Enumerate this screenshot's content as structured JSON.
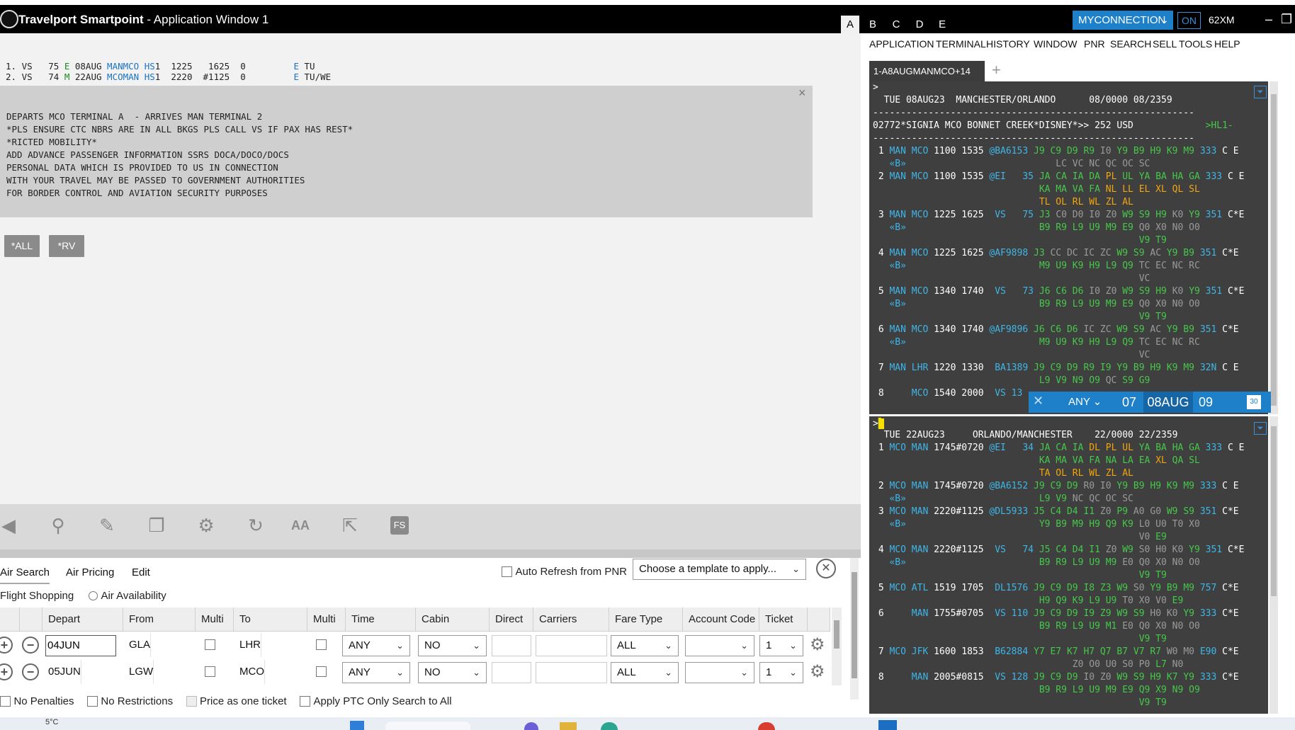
{
  "window": {
    "app_name": "Travelport Smartpoint",
    "title_suffix": " - Application Window 1",
    "tabs": [
      "A",
      "B",
      "C",
      "D",
      "E"
    ],
    "connection": "MYCONNECTION",
    "on_label": "ON",
    "station": "62XM"
  },
  "segments": {
    "line1": {
      "num": "1. VS",
      "flight": "75",
      "cls": "E",
      "date": "08AUG",
      "city": "MANMCO",
      "status": "HS",
      "rest": "1  1225   1625  0         ",
      "e": "E",
      "days": "TU"
    },
    "line2": {
      "num": "2. VS",
      "flight": "74",
      "cls": "M",
      "date": "22AUG",
      "city": "MCOMAN",
      "status": "HS",
      "rest": "1  2220  #1125  0         ",
      "e": "E",
      "days": "TU/WE"
    }
  },
  "info": {
    "lines": [
      "DEPARTS MCO TERMINAL A  - ARRIVES MAN TERMINAL 2",
      "*PLS ENSURE CTC NBRS ARE IN ALL BKGS PLS CALL VS IF PAX HAS REST*",
      "*RICTED MOBILITY*",
      "ADD ADVANCE PASSENGER INFORMATION SSRS DOCA/DOCO/DOCS",
      "PERSONAL DATA WHICH IS PROVIDED TO US IN CONNECTION",
      "WITH YOUR TRAVEL MAY BE PASSED TO GOVERNMENT AUTHORITIES",
      "FOR BORDER CONTROL AND AVIATION SECURITY PURPOSES"
    ],
    "close": "×"
  },
  "quick_buttons": [
    "*ALL",
    "*RV"
  ],
  "toolbar_icons": [
    "megaphone-icon",
    "search-icon",
    "pencil-icon",
    "copy-icon",
    "gear-icon",
    "refresh-icon",
    "font-size-icon",
    "external-link-icon",
    "fs-icon"
  ],
  "form": {
    "tabs": [
      "Air Search",
      "Air Pricing",
      "Edit"
    ],
    "auto_refresh": "Auto Refresh from PNR",
    "template_placeholder": "Choose a template to apply...",
    "search_types": [
      "Flight Shopping",
      "Air Availability"
    ],
    "columns": [
      "Depart",
      "From",
      "Multi",
      "To",
      "Multi",
      "Time",
      "Cabin",
      "Direct",
      "Carriers",
      "Fare Type",
      "Account Code",
      "Ticket"
    ],
    "rows": [
      {
        "depart": "04JUN",
        "from": "GLA",
        "to": "LHR",
        "time": "ANY",
        "cabin": "NO",
        "fare": "ALL",
        "ticket": "1"
      },
      {
        "depart": "05JUN",
        "from": "LGW",
        "to": "MCO",
        "time": "ANY",
        "cabin": "NO",
        "fare": "ALL",
        "ticket": "1"
      }
    ],
    "options": [
      "No Penalties",
      "No Restrictions",
      "Price as one ticket",
      "Apply PTC Only Search to All"
    ]
  },
  "menu": [
    "APPLICATION",
    "TERMINAL",
    "HISTORY",
    "WINDOW",
    "PNR",
    "SEARCH",
    "SELL",
    "TOOLS",
    "HELP"
  ],
  "session_tab": "1-A8AUGMANMCO+14",
  "terminal1": {
    "prompt": ">",
    "header": "  TUE 08AUG23  MANCHESTER/ORLANDO      08/0000 08/2359",
    "rule": "----------------------------------------------------------",
    "promo": "02772*SIGNIA MCO BONNET CREEK*DISNEY*>> 252 USD",
    "promo_tag": ">HL1-"
  },
  "datebar": {
    "any": "ANY",
    "prev": "07",
    "current": "08AUG",
    "next": "09",
    "cal": "30"
  },
  "terminal2": {
    "prompt": ">",
    "header": "  TUE 22AUG23     ORLANDO/MANCHESTER    22/0000 22/2359"
  },
  "taskbar": {
    "temp": "5°C"
  }
}
